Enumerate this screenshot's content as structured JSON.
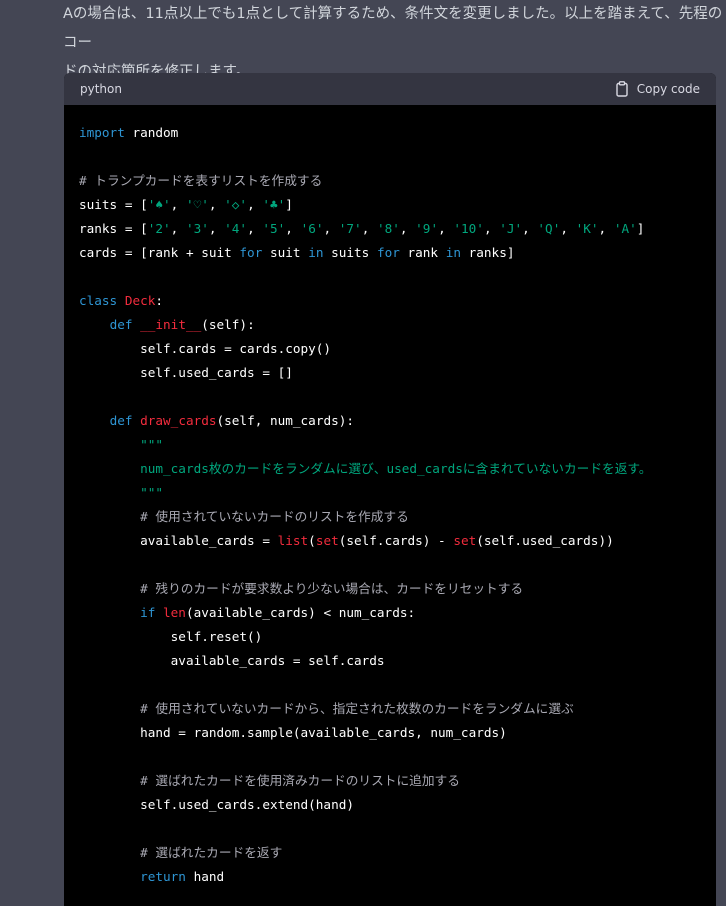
{
  "message": {
    "line1": "Aの場合は、11点以上でも1点として計算するため、条件文を変更しました。以上を踏まえて、先程のコー",
    "line2": "ドの対応箇所を修正します。"
  },
  "code_block": {
    "language": "python",
    "copy_label": "Copy code",
    "lines": [
      [
        [
          "kw",
          "import"
        ],
        [
          "plain",
          " random"
        ]
      ],
      [],
      [
        [
          "cm",
          "# トランプカードを表すリストを作成する"
        ]
      ],
      [
        [
          "plain",
          "suits = ["
        ],
        [
          "str",
          "'♠'"
        ],
        [
          "plain",
          ", "
        ],
        [
          "str",
          "'♡'"
        ],
        [
          "plain",
          ", "
        ],
        [
          "str",
          "'◇'"
        ],
        [
          "plain",
          ", "
        ],
        [
          "str",
          "'♣'"
        ],
        [
          "plain",
          "]"
        ]
      ],
      [
        [
          "plain",
          "ranks = ["
        ],
        [
          "str",
          "'2'"
        ],
        [
          "plain",
          ", "
        ],
        [
          "str",
          "'3'"
        ],
        [
          "plain",
          ", "
        ],
        [
          "str",
          "'4'"
        ],
        [
          "plain",
          ", "
        ],
        [
          "str",
          "'5'"
        ],
        [
          "plain",
          ", "
        ],
        [
          "str",
          "'6'"
        ],
        [
          "plain",
          ", "
        ],
        [
          "str",
          "'7'"
        ],
        [
          "plain",
          ", "
        ],
        [
          "str",
          "'8'"
        ],
        [
          "plain",
          ", "
        ],
        [
          "str",
          "'9'"
        ],
        [
          "plain",
          ", "
        ],
        [
          "str",
          "'10'"
        ],
        [
          "plain",
          ", "
        ],
        [
          "str",
          "'J'"
        ],
        [
          "plain",
          ", "
        ],
        [
          "str",
          "'Q'"
        ],
        [
          "plain",
          ", "
        ],
        [
          "str",
          "'K'"
        ],
        [
          "plain",
          ", "
        ],
        [
          "str",
          "'A'"
        ],
        [
          "plain",
          "]"
        ]
      ],
      [
        [
          "plain",
          "cards = [rank + suit "
        ],
        [
          "kw",
          "for"
        ],
        [
          "plain",
          " suit "
        ],
        [
          "kw",
          "in"
        ],
        [
          "plain",
          " suits "
        ],
        [
          "kw",
          "for"
        ],
        [
          "plain",
          " rank "
        ],
        [
          "kw",
          "in"
        ],
        [
          "plain",
          " ranks]"
        ]
      ],
      [],
      [
        [
          "kw",
          "class"
        ],
        [
          "plain",
          " "
        ],
        [
          "fn",
          "Deck"
        ],
        [
          "plain",
          ":"
        ]
      ],
      [
        [
          "plain",
          "    "
        ],
        [
          "kw",
          "def"
        ],
        [
          "plain",
          " "
        ],
        [
          "fn",
          "__init__"
        ],
        [
          "plain",
          "(self):"
        ]
      ],
      [
        [
          "plain",
          "        self.cards = cards.copy()"
        ]
      ],
      [
        [
          "plain",
          "        self.used_cards = []"
        ]
      ],
      [],
      [
        [
          "plain",
          "    "
        ],
        [
          "kw",
          "def"
        ],
        [
          "plain",
          " "
        ],
        [
          "fn",
          "draw_cards"
        ],
        [
          "plain",
          "(self, num_cards):"
        ]
      ],
      [
        [
          "plain",
          "        "
        ],
        [
          "str",
          "\"\"\""
        ]
      ],
      [
        [
          "plain",
          "        "
        ],
        [
          "str",
          "num_cards枚のカードをランダムに選び、used_cardsに含まれていないカードを返す。"
        ]
      ],
      [
        [
          "plain",
          "        "
        ],
        [
          "str",
          "\"\"\""
        ]
      ],
      [
        [
          "plain",
          "        "
        ],
        [
          "cm",
          "# 使用されていないカードのリストを作成する"
        ]
      ],
      [
        [
          "plain",
          "        available_cards = "
        ],
        [
          "fn",
          "list"
        ],
        [
          "plain",
          "("
        ],
        [
          "fn",
          "set"
        ],
        [
          "plain",
          "(self.cards) - "
        ],
        [
          "fn",
          "set"
        ],
        [
          "plain",
          "(self.used_cards))"
        ]
      ],
      [],
      [
        [
          "plain",
          "        "
        ],
        [
          "cm",
          "# 残りのカードが要求数より少ない場合は、カードをリセットする"
        ]
      ],
      [
        [
          "plain",
          "        "
        ],
        [
          "kw",
          "if"
        ],
        [
          "plain",
          " "
        ],
        [
          "fn",
          "len"
        ],
        [
          "plain",
          "(available_cards) < num_cards:"
        ]
      ],
      [
        [
          "plain",
          "            self.reset()"
        ]
      ],
      [
        [
          "plain",
          "            available_cards = self.cards"
        ]
      ],
      [],
      [
        [
          "plain",
          "        "
        ],
        [
          "cm",
          "# 使用されていないカードから、指定された枚数のカードをランダムに選ぶ"
        ]
      ],
      [
        [
          "plain",
          "        hand = random.sample(available_cards, num_cards)"
        ]
      ],
      [],
      [
        [
          "plain",
          "        "
        ],
        [
          "cm",
          "# 選ばれたカードを使用済みカードのリストに追加する"
        ]
      ],
      [
        [
          "plain",
          "        self.used_cards.extend(hand)"
        ]
      ],
      [],
      [
        [
          "plain",
          "        "
        ],
        [
          "cm",
          "# 選ばれたカードを返す"
        ]
      ],
      [
        [
          "plain",
          "        "
        ],
        [
          "kw",
          "return"
        ],
        [
          "plain",
          " hand"
        ]
      ]
    ]
  },
  "icons": {
    "copy": "clipboard-icon"
  }
}
